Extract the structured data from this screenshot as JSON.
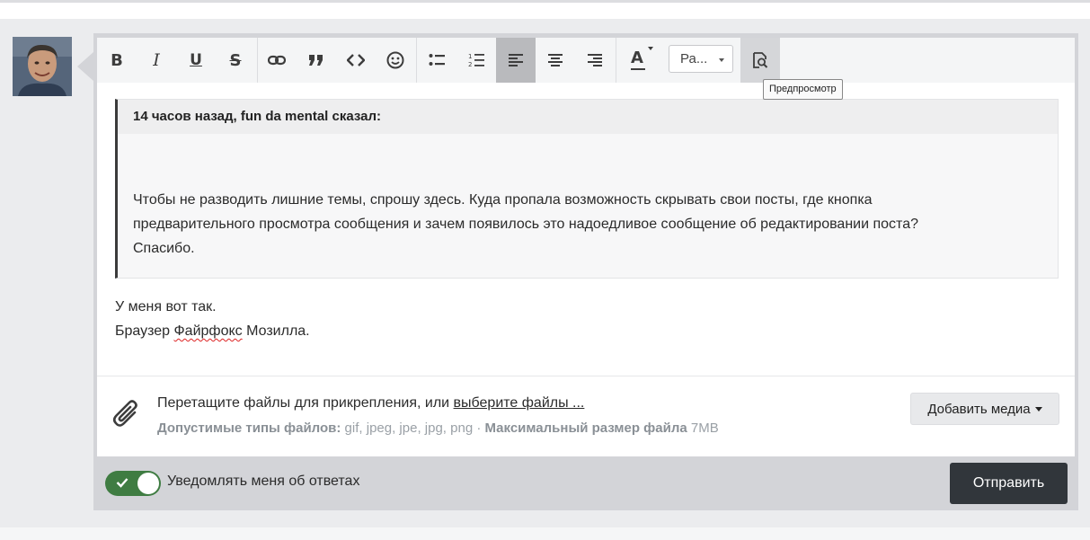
{
  "toolbar": {
    "bold_label": "B",
    "italic_label": "I",
    "underline_label": "U",
    "strike_label": "S",
    "font_color_label": "A",
    "paragraph_value": "Ра...",
    "preview_tooltip": "Предпросмотр",
    "active_button": "align-left"
  },
  "quote": {
    "header": "14 часов назад, fun da mental сказал:",
    "lines": [
      "Чтобы не разводить лишние темы, спрошу здесь. Куда пропала возможность скрывать свои посты, где кнопка",
      "предварительного просмотра сообщения и зачем появилось это надоедливое сообщение об редактировании поста?",
      "Спасибо."
    ]
  },
  "reply": {
    "line1": "У меня вот так.",
    "line2_before": "Браузер ",
    "line2_misspelled": "Файрфокс",
    "line2_after": " Мозилла."
  },
  "attachments": {
    "prompt": "Перетащите файлы для прикрепления, или ",
    "link": "выберите файлы ...",
    "types_label": "Допустимые типы файлов:",
    "types_value": " gif, jpeg, jpe, jpg, png · ",
    "max_label": "Максимальный размер файла",
    "max_value": " 7MB",
    "add_media_button": "Добавить медиа"
  },
  "footer": {
    "notify_label": "Уведомлять меня об ответах",
    "notify_enabled": true,
    "submit_button": "Отправить"
  },
  "colors": {
    "toggle_on": "#3f7c42",
    "submit_bg": "#31363b",
    "frame_bg": "#d3d4d8",
    "page_bg": "#ebecee"
  }
}
